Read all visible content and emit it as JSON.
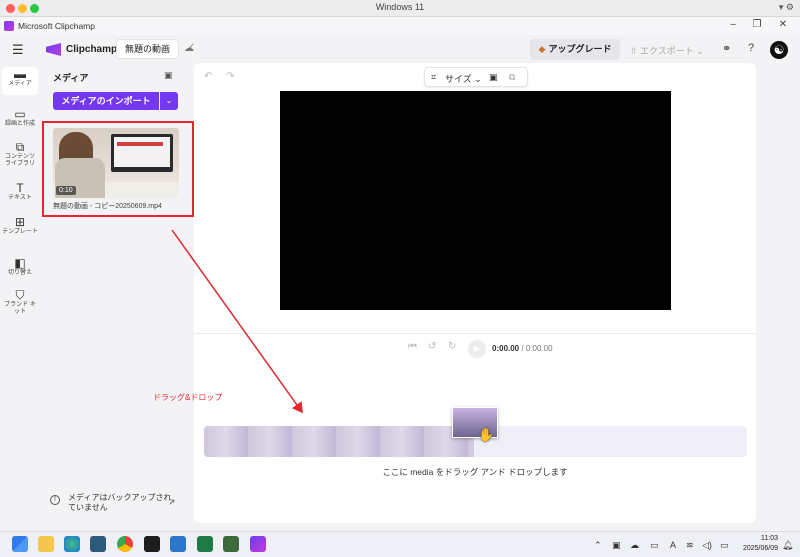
{
  "mac": {
    "title": "Windows 11"
  },
  "window": {
    "title": "Microsoft Clipchamp"
  },
  "header": {
    "brand": "Clipchamp",
    "project_title": "無題の動画",
    "upgrade_label": "アップグレード",
    "export_label": "エクスポート"
  },
  "nav": {
    "items": [
      {
        "label": "メディア",
        "icon": "folder-icon"
      },
      {
        "label": "録画と作成",
        "icon": "camera-icon"
      },
      {
        "label": "コンテンツ ライブラリ",
        "icon": "library-icon"
      },
      {
        "label": "テキスト",
        "icon": "text-icon"
      },
      {
        "label": "テンプレート",
        "icon": "template-icon"
      },
      {
        "label": "切り替え",
        "icon": "transition-icon"
      },
      {
        "label": "ブランド キット",
        "icon": "brand-kit-icon"
      }
    ]
  },
  "media": {
    "title": "メディア",
    "import_label": "メディアのインポート",
    "clip": {
      "duration": "0:10",
      "filename": "無題の動画 - コピー20250609.mp4"
    },
    "backup_notice": "メディアはバックアップされていません"
  },
  "editor": {
    "size_label": "サイズ",
    "timecode_current": "0:00.00",
    "timecode_total": "/ 0:00.00",
    "drop_hint": "ここに media をドラッグ アンド ドロップします"
  },
  "annotation": {
    "text": "ドラッグ&ドロップ",
    "color": "#e0282e"
  },
  "taskbar": {
    "time": "11:03",
    "date": "2025/06/09"
  },
  "colors": {
    "accent": "#7438f0",
    "annotation": "#e0282e"
  }
}
